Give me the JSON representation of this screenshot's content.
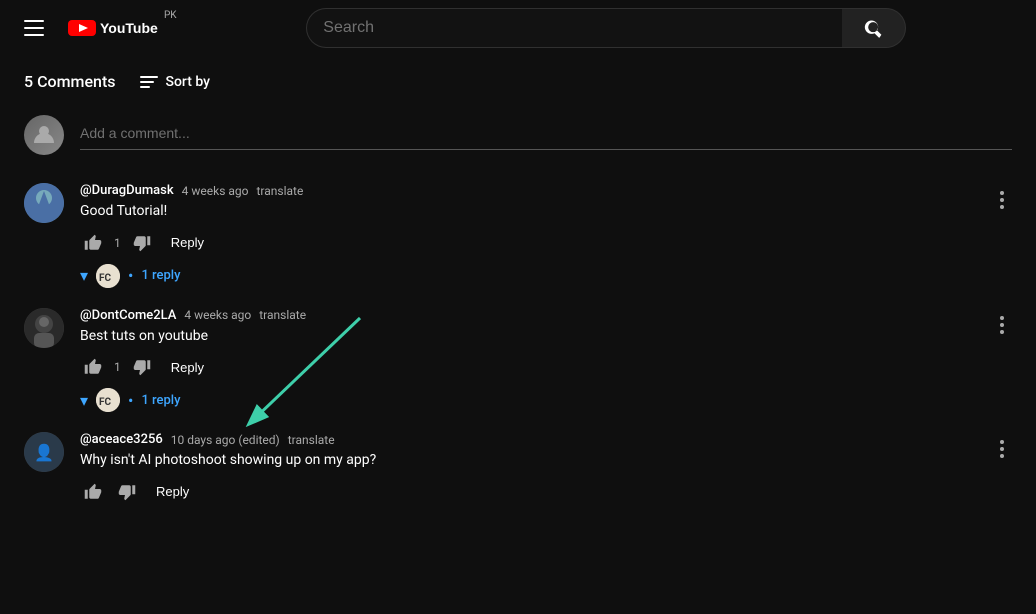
{
  "header": {
    "search_placeholder": "Search",
    "country_code": "PK"
  },
  "comments_section": {
    "count_label": "5 Comments",
    "sort_by_label": "Sort by",
    "add_comment_placeholder": "Add a comment...",
    "comments": [
      {
        "id": "durags",
        "username": "@DuragDumask",
        "time": "4 weeks ago",
        "translate": "translate",
        "text": "Good Tutorial!",
        "likes": "1",
        "replies_count": "1 reply",
        "has_replies": true
      },
      {
        "id": "dontcome",
        "username": "@DontCome2LA",
        "time": "4 weeks ago",
        "translate": "translate",
        "text": "Best tuts on youtube",
        "likes": "1",
        "replies_count": "1 reply",
        "has_replies": true
      },
      {
        "id": "ace",
        "username": "@aceace3256",
        "time": "10 days ago (edited)",
        "translate": "translate",
        "text": "Why isn't AI photoshoot showing up on my app?",
        "likes": "",
        "replies_count": "",
        "has_replies": false
      }
    ]
  },
  "buttons": {
    "reply_label": "Reply"
  }
}
